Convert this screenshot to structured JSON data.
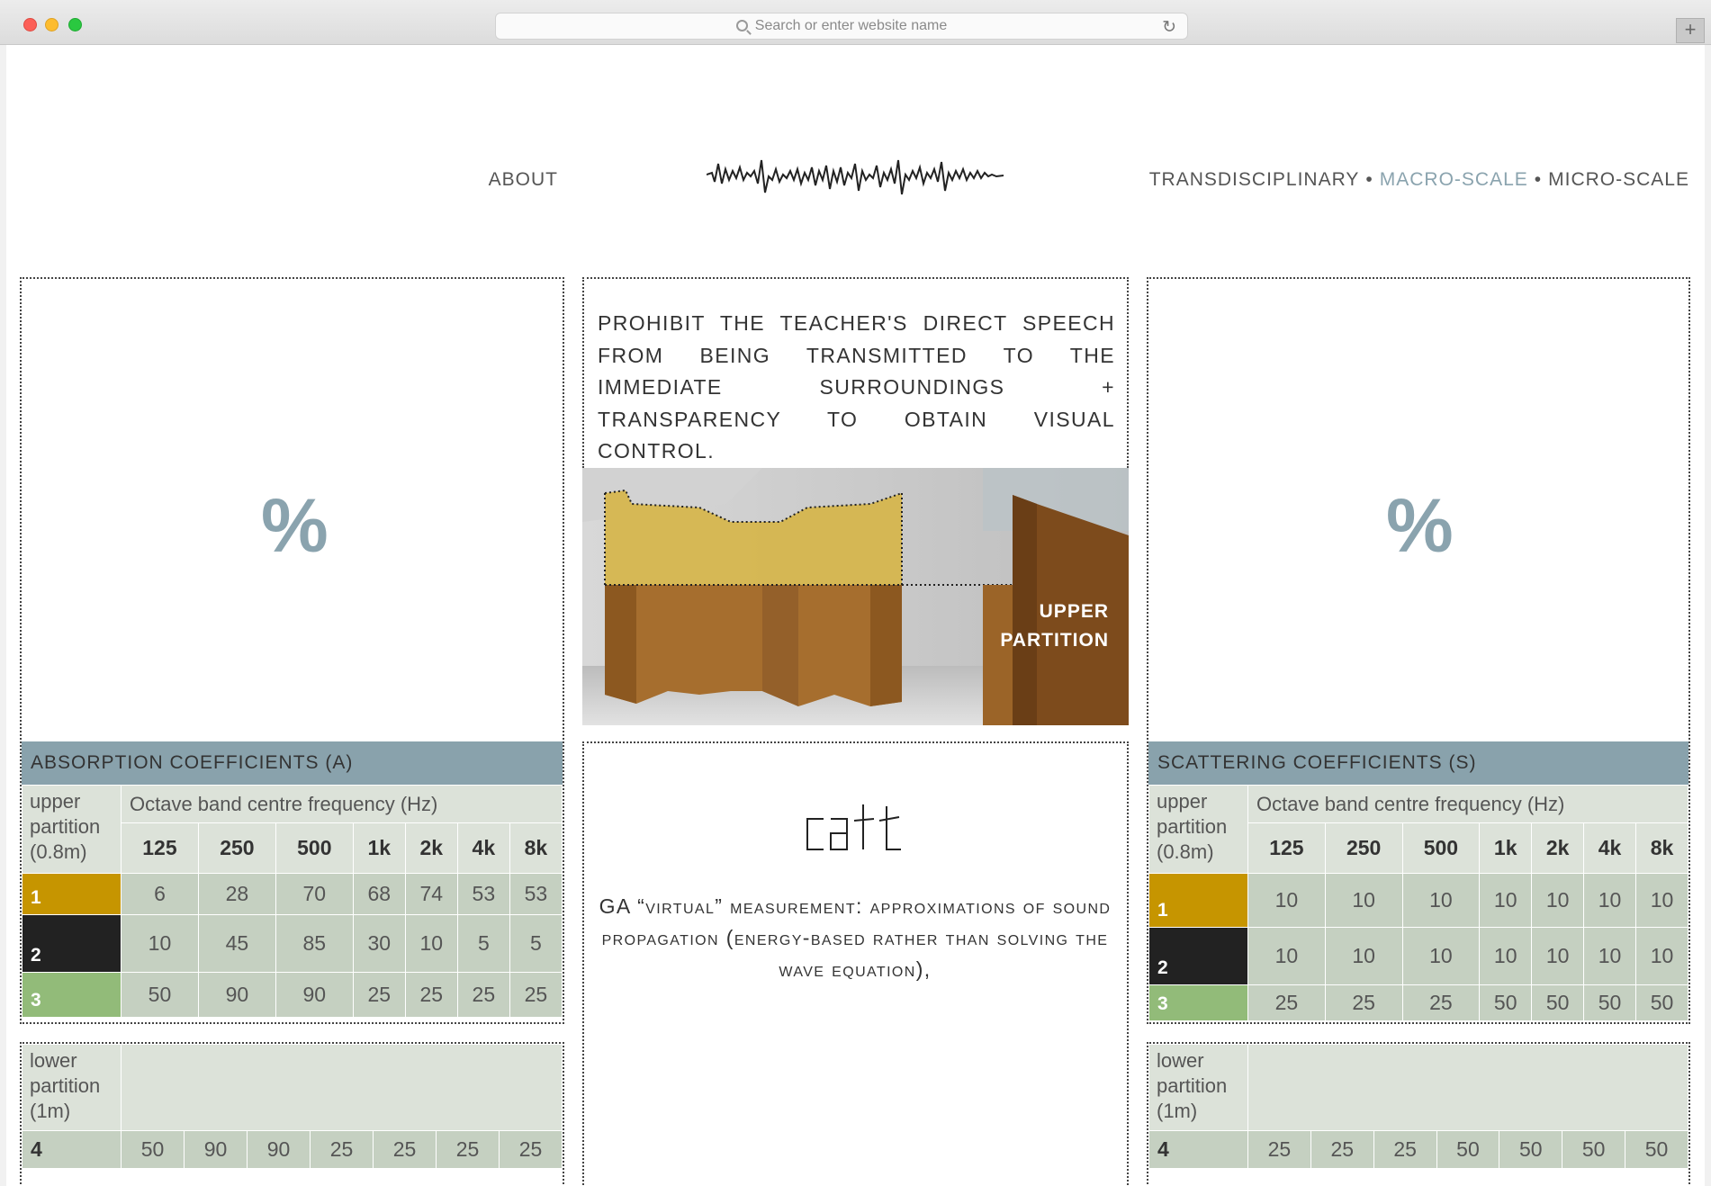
{
  "browser": {
    "address_placeholder": "Search or enter website name",
    "reload_icon": "reload-icon",
    "new_tab_label": "+"
  },
  "nav": {
    "about": "ABOUT",
    "transdisciplinary": "TRANSDISCIPLINARY",
    "sep1": "•",
    "macro": "MACRO-SCALE",
    "sep2": "•",
    "micro": "MICRO-SCALE",
    "active_color": "#8aa3ae"
  },
  "left": {
    "percent": "%",
    "title": "ABSORPTION COEFFICIENTS (A)"
  },
  "right": {
    "percent": "%",
    "title": "SCATTERING COEFFICIENTS (S)"
  },
  "middle": {
    "intro": "PROHIBIT THE TEACHER'S DIRECT SPEECH FROM BEING TRANSMITTED TO THE IMMEDIATE SURROUNDINGS + TRANSPARENCY TO OBTAIN VISUAL CONTROL.",
    "render_label_1": "UPPER",
    "render_label_2": "PARTITION",
    "catt_logo": "catt",
    "ga_text": "GA “virtual” measurement: approximations of sound propagation (energy-based rather than solving the wave equation),"
  },
  "tables": {
    "upper_label_1": "upper",
    "upper_label_2": "partition",
    "upper_label_3": "(0.8m)",
    "lower_label_1": "lower",
    "lower_label_2": "partition",
    "lower_label_3": "(1m)",
    "octave": "Octave band centre frequency (Hz)",
    "freqs": [
      "125",
      "250",
      "500",
      "1k",
      "2k",
      "4k",
      "8k"
    ],
    "absorption": {
      "rows": [
        {
          "label": "1",
          "color": "#c69500",
          "values": [
            "6",
            "28",
            "70",
            "68",
            "74",
            "53",
            "53"
          ]
        },
        {
          "label": "2",
          "color": "#222222",
          "values": [
            "10",
            "45",
            "85",
            "30",
            "10",
            "5",
            "5"
          ]
        },
        {
          "label": "3",
          "color": "#92bb79",
          "values": [
            "50",
            "90",
            "90",
            "25",
            "25",
            "25",
            "25"
          ]
        }
      ],
      "row4": {
        "label": "4",
        "values": [
          "50",
          "90",
          "90",
          "25",
          "25",
          "25",
          "25"
        ]
      }
    },
    "scattering": {
      "rows": [
        {
          "label": "1",
          "color": "#c69500",
          "values": [
            "10",
            "10",
            "10",
            "10",
            "10",
            "10",
            "10"
          ]
        },
        {
          "label": "2",
          "color": "#222222",
          "values": [
            "10",
            "10",
            "10",
            "10",
            "10",
            "10",
            "10"
          ]
        },
        {
          "label": "3",
          "color": "#92bb79",
          "values": [
            "25",
            "25",
            "25",
            "50",
            "50",
            "50",
            "50"
          ]
        }
      ],
      "row4": {
        "label": "4",
        "values": [
          "25",
          "25",
          "25",
          "50",
          "50",
          "50",
          "50"
        ]
      }
    }
  }
}
